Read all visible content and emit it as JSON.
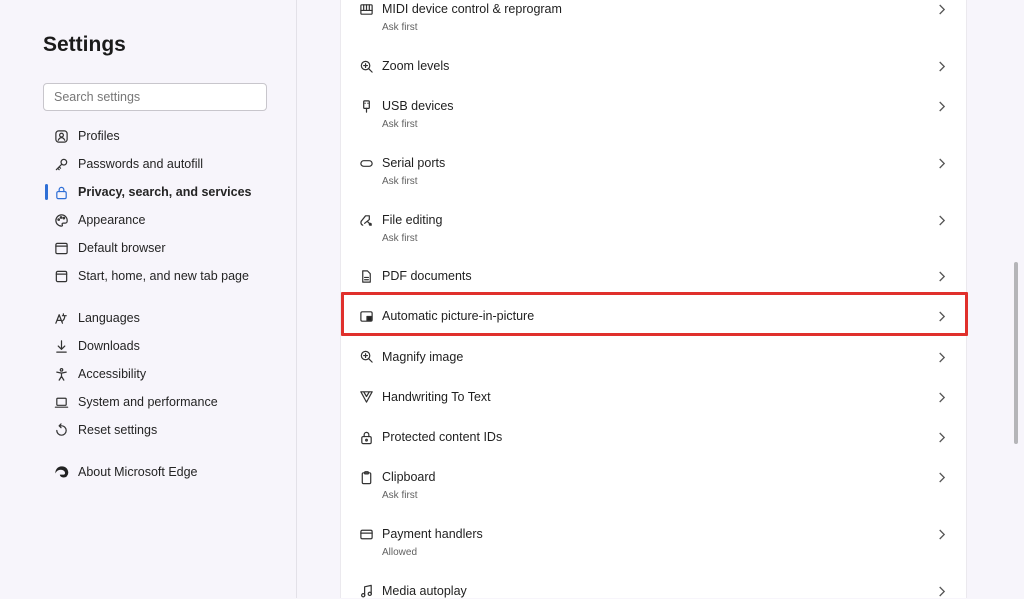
{
  "sidebar": {
    "title": "Settings",
    "search_placeholder": "Search settings",
    "items": [
      {
        "label": "Profiles",
        "icon": "profile-icon"
      },
      {
        "label": "Passwords and autofill",
        "icon": "key-icon"
      },
      {
        "label": "Privacy, search, and services",
        "icon": "lock-icon",
        "active": true
      },
      {
        "label": "Appearance",
        "icon": "palette-icon"
      },
      {
        "label": "Default browser",
        "icon": "browser-icon"
      },
      {
        "label": "Start, home, and new tab page",
        "icon": "home-icon"
      },
      {
        "label": "Languages",
        "icon": "languages-icon"
      },
      {
        "label": "Downloads",
        "icon": "download-icon"
      },
      {
        "label": "Accessibility",
        "icon": "accessibility-icon"
      },
      {
        "label": "System and performance",
        "icon": "laptop-icon"
      },
      {
        "label": "Reset settings",
        "icon": "reset-icon"
      },
      {
        "label": "About Microsoft Edge",
        "icon": "edge-logo-icon"
      }
    ]
  },
  "permissions": [
    {
      "name": "MIDI device control & reprogram",
      "sub": "Ask first",
      "icon": "midi-icon"
    },
    {
      "name": "Zoom levels",
      "sub": "",
      "icon": "zoom-icon"
    },
    {
      "name": "USB devices",
      "sub": "Ask first",
      "icon": "usb-icon"
    },
    {
      "name": "Serial ports",
      "sub": "Ask first",
      "icon": "serial-port-icon"
    },
    {
      "name": "File editing",
      "sub": "Ask first",
      "icon": "file-edit-icon"
    },
    {
      "name": "PDF documents",
      "sub": "",
      "icon": "pdf-icon"
    },
    {
      "name": "Automatic picture-in-picture",
      "sub": "",
      "icon": "picture-in-picture-icon"
    },
    {
      "name": "Magnify image",
      "sub": "",
      "icon": "magnify-icon"
    },
    {
      "name": "Handwriting To Text",
      "sub": "",
      "icon": "handwriting-icon"
    },
    {
      "name": "Protected content IDs",
      "sub": "",
      "icon": "protected-content-icon"
    },
    {
      "name": "Clipboard",
      "sub": "Ask first",
      "icon": "clipboard-icon"
    },
    {
      "name": "Payment handlers",
      "sub": "Allowed",
      "icon": "payment-icon"
    },
    {
      "name": "Media autoplay",
      "sub": "",
      "icon": "music-note-icon"
    }
  ],
  "colors": {
    "accent": "#2f6fd6",
    "highlight": "#e0302c"
  }
}
